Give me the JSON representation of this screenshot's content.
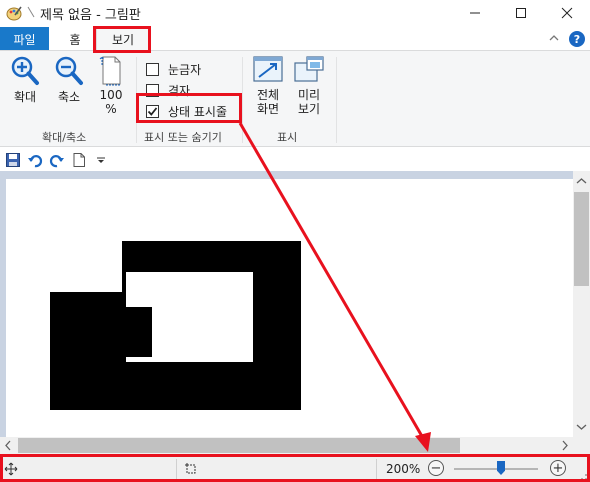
{
  "window": {
    "title": "제목 없음 - 그림판",
    "minimize_glyph": "—",
    "close_glyph": "✕"
  },
  "tabs": {
    "file": "파일",
    "home": "홈",
    "view": "보기"
  },
  "help_glyph": "?",
  "ribbon": {
    "zoom_group": {
      "label": "확대/축소",
      "zoom_in": "확대",
      "zoom_out": "축소",
      "actual_size_line1": "100",
      "actual_size_line2": "%"
    },
    "show_hide_group": {
      "label": "표시 또는 숨기기",
      "rulers": {
        "label": "눈금자",
        "checked": false
      },
      "gridlines": {
        "label": "격자",
        "checked": false
      },
      "status_bar": {
        "label": "상태 표시줄",
        "checked": true
      }
    },
    "display_group": {
      "label": "표시",
      "full_screen_line1": "전체",
      "full_screen_line2": "화면",
      "thumbnail_line1": "미리",
      "thumbnail_line2": "보기"
    }
  },
  "statusbar": {
    "zoom_label": "200%",
    "zoom_minus": "−",
    "zoom_plus": "+"
  },
  "colors": {
    "accent": "#1979ca",
    "highlight": "#e8111e",
    "workspace": "#c9d3e2"
  }
}
